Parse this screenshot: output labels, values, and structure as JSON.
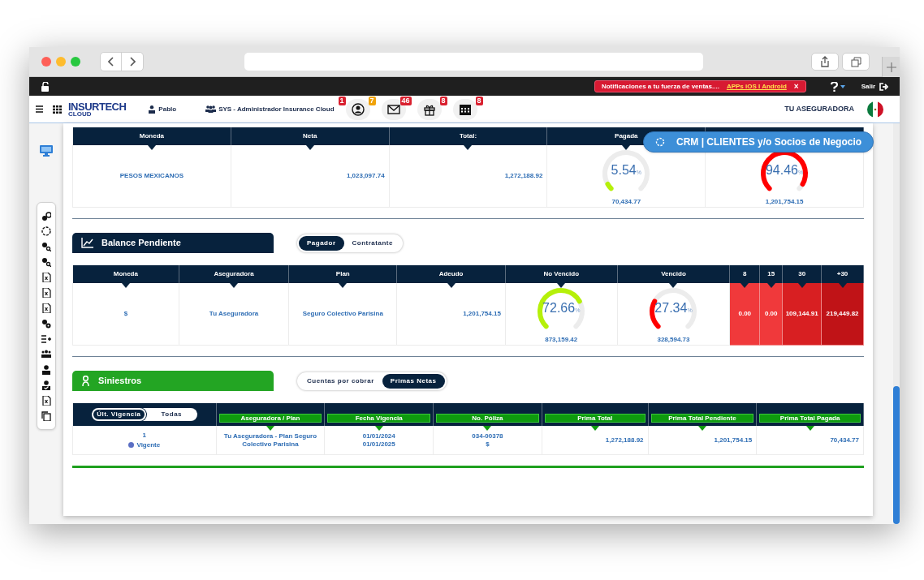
{
  "topbar": {
    "notification": {
      "text": "Notificaciones a tu fuerza de ventas....",
      "link": "APPs iOS I Android",
      "close": "×"
    },
    "logout": "Salir"
  },
  "header": {
    "logo": {
      "name": "INSURTECH",
      "sub": "CLOUD"
    },
    "user": "Pablo",
    "role": "SYS - Administrador Insurance Cloud",
    "icons": [
      {
        "kind": "contacts",
        "badges": [
          {
            "text": "1",
            "color": "#d9202f"
          },
          {
            "text": "7",
            "color": "#f0a20a"
          }
        ]
      },
      {
        "kind": "mail",
        "badges": [
          {
            "text": "46",
            "color": "#d9202f"
          }
        ]
      },
      {
        "kind": "gift",
        "badges": [
          {
            "text": "8",
            "color": "#d9202f"
          }
        ]
      },
      {
        "kind": "calendar",
        "badges": [
          {
            "text": "8",
            "color": "#d9202f"
          }
        ]
      }
    ],
    "company": "TU ASEGURADORA"
  },
  "crm_button": "CRM | CLIENTES y/o Socios de Negocio",
  "summary": {
    "columns": [
      "Moneda",
      "Neta",
      "Total:",
      "Pagada"
    ],
    "cells": [
      {
        "kind": "text",
        "value": "PESOS MEXICANOS"
      },
      {
        "kind": "amount",
        "value": "1,023,097.74"
      },
      {
        "kind": "amount",
        "value": "1,272,188.92"
      },
      {
        "kind": "gauge",
        "value": "5.54",
        "unit": "%",
        "color": "#b5f00a",
        "amount": "70,434.77"
      },
      {
        "kind": "gauge",
        "value": "94.46",
        "unit": "%",
        "color": "#ff0000",
        "amount": "1,201,754.15"
      }
    ]
  },
  "balance": {
    "title": "Balance Pendiente",
    "toggle": [
      {
        "label": "Pagador",
        "selected": true
      },
      {
        "label": "Contratante",
        "selected": false
      }
    ],
    "columns": [
      "Moneda",
      "Aseguradora",
      "Plan",
      "Adeudo",
      "No Vencido",
      "Vencido",
      "8",
      "15",
      "30",
      "+30"
    ],
    "cells": [
      {
        "kind": "text",
        "value": "$"
      },
      {
        "kind": "text",
        "value": "Tu Aseguradora"
      },
      {
        "kind": "text",
        "value": "Seguro Colectivo Parisina"
      },
      {
        "kind": "amount",
        "value": "1,201,754.15"
      },
      {
        "kind": "gauge",
        "value": "72.66",
        "unit": "%",
        "color": "#b5f00a",
        "amount": "873,159.42"
      },
      {
        "kind": "gauge",
        "value": "27.34",
        "unit": "%",
        "color": "#ff0000",
        "amount": "328,594.73"
      },
      {
        "kind": "aging",
        "value": "0.00",
        "color": "#f0393b"
      },
      {
        "kind": "aging",
        "value": "0.00",
        "color": "#f0393b"
      },
      {
        "kind": "aging",
        "value": "109,144.91",
        "color": "#d81f22"
      },
      {
        "kind": "aging",
        "value": "219,449.82",
        "color": "#c01317"
      }
    ]
  },
  "siniestros": {
    "title": "Siniestros",
    "toggle": [
      {
        "label": "Cuentas por cobrar",
        "selected": false
      },
      {
        "label": "Primas Netas",
        "selected": true
      }
    ],
    "filter": [
      {
        "label": "Últ. Vigencia",
        "selected": true
      },
      {
        "label": "Todas",
        "selected": false
      }
    ],
    "columns": [
      "Aseguradora / Plan",
      "Fecha Vigencia",
      "No. Póliza",
      "Prima Total",
      "Prima Total Pendiente",
      "Prima Total Pagada"
    ],
    "row": {
      "number": "1",
      "status": {
        "label": "Vigente",
        "color": "#5b6fc4"
      },
      "cells": [
        {
          "kind": "text",
          "lines": [
            "Tu Aseguradora - Plan Seguro Colectivo Parisina"
          ]
        },
        {
          "kind": "text",
          "lines": [
            "01/01/2024",
            "01/01/2025"
          ]
        },
        {
          "kind": "text",
          "lines": [
            "034-00378",
            "$"
          ]
        },
        {
          "kind": "amount",
          "lines": [
            "1,272,188.92"
          ]
        },
        {
          "kind": "amount",
          "lines": [
            "1,201,754.15"
          ]
        },
        {
          "kind": "amount",
          "lines": [
            "70,434.77"
          ]
        }
      ]
    }
  }
}
